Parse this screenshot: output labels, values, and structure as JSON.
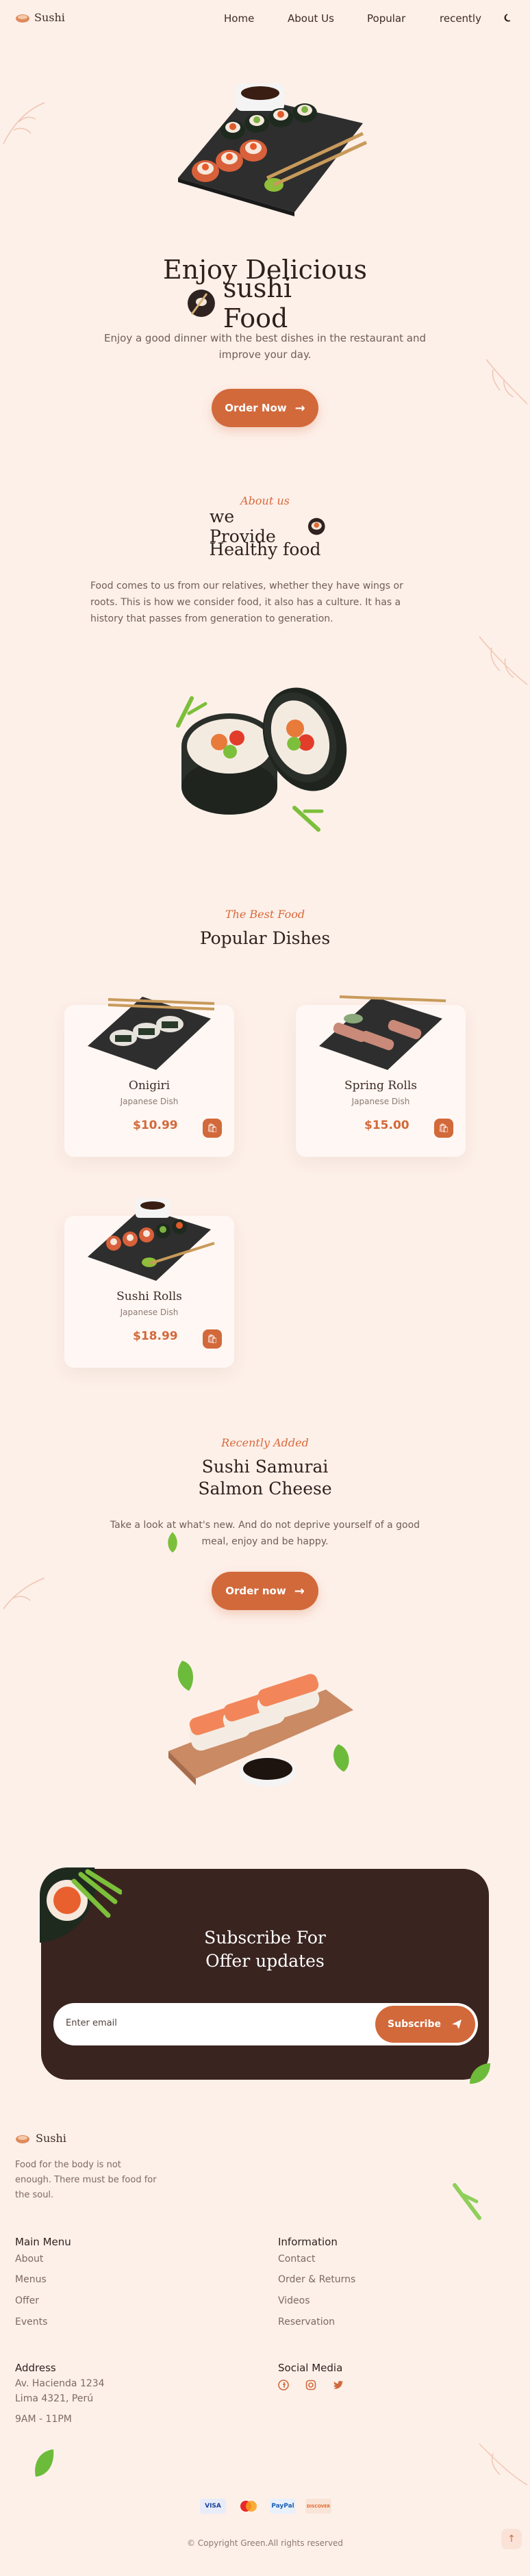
{
  "header": {
    "logo_text": "Sushi",
    "nav": [
      "Home",
      "About Us",
      "Popular",
      "recently"
    ]
  },
  "hero": {
    "title_line1": "Enjoy Delicious",
    "title_line2": "sushi Food",
    "description": "Enjoy a good dinner with the best dishes in the restaurant and improve your day.",
    "button_label": "Order Now"
  },
  "about": {
    "eyebrow": "About us",
    "title_line1": "we Provide",
    "title_line2": "Healthy food",
    "description": "Food comes to us from our relatives, whether they have wings or roots. This is how we consider food, it also has a culture. It has a history that passes from generation to generation."
  },
  "popular": {
    "eyebrow": "The Best Food",
    "title": "Popular Dishes",
    "dishes": [
      {
        "name": "Onigiri",
        "category": "Japanese Dish",
        "price": "$10.99"
      },
      {
        "name": "Spring Rolls",
        "category": "Japanese Dish",
        "price": "$15.00"
      },
      {
        "name": "Sushi Rolls",
        "category": "Japanese Dish",
        "price": "$18.99"
      }
    ]
  },
  "recently": {
    "eyebrow": "Recently Added",
    "title_line1": "Sushi Samurai",
    "title_line2": "Salmon Cheese",
    "description": "Take a look at what's new. And do not deprive yourself of a good meal, enjoy and be happy.",
    "button_label": "Order now"
  },
  "subscribe": {
    "title_line1": "Subscribe For",
    "title_line2": "Offer updates",
    "placeholder": "Enter email",
    "button_label": "Subscribe"
  },
  "footer": {
    "logo_text": "Sushi",
    "tagline": "Food for the body is not enough. There must be food for the soul.",
    "main_menu": {
      "title": "Main Menu",
      "items": [
        "About",
        "Menus",
        "Offer",
        "Events"
      ]
    },
    "information": {
      "title": "Information",
      "items": [
        "Contact",
        "Order & Returns",
        "Videos",
        "Reservation"
      ]
    },
    "address": {
      "title": "Address",
      "lines": [
        "Av. Hacienda 1234",
        "Lima 4321, Perú"
      ],
      "hours": "9AM - 11PM"
    },
    "social": {
      "title": "Social Media",
      "icons": [
        "facebook-icon",
        "instagram-icon",
        "twitter-icon"
      ]
    },
    "payments": [
      "VISA",
      "mastercard",
      "PayPal",
      "DISCOVER"
    ],
    "copyright": "© Copyright Green.All rights reserved"
  },
  "colors": {
    "accent": "#d2693b",
    "background": "#fdf0e9",
    "dark": "#3a2420"
  }
}
